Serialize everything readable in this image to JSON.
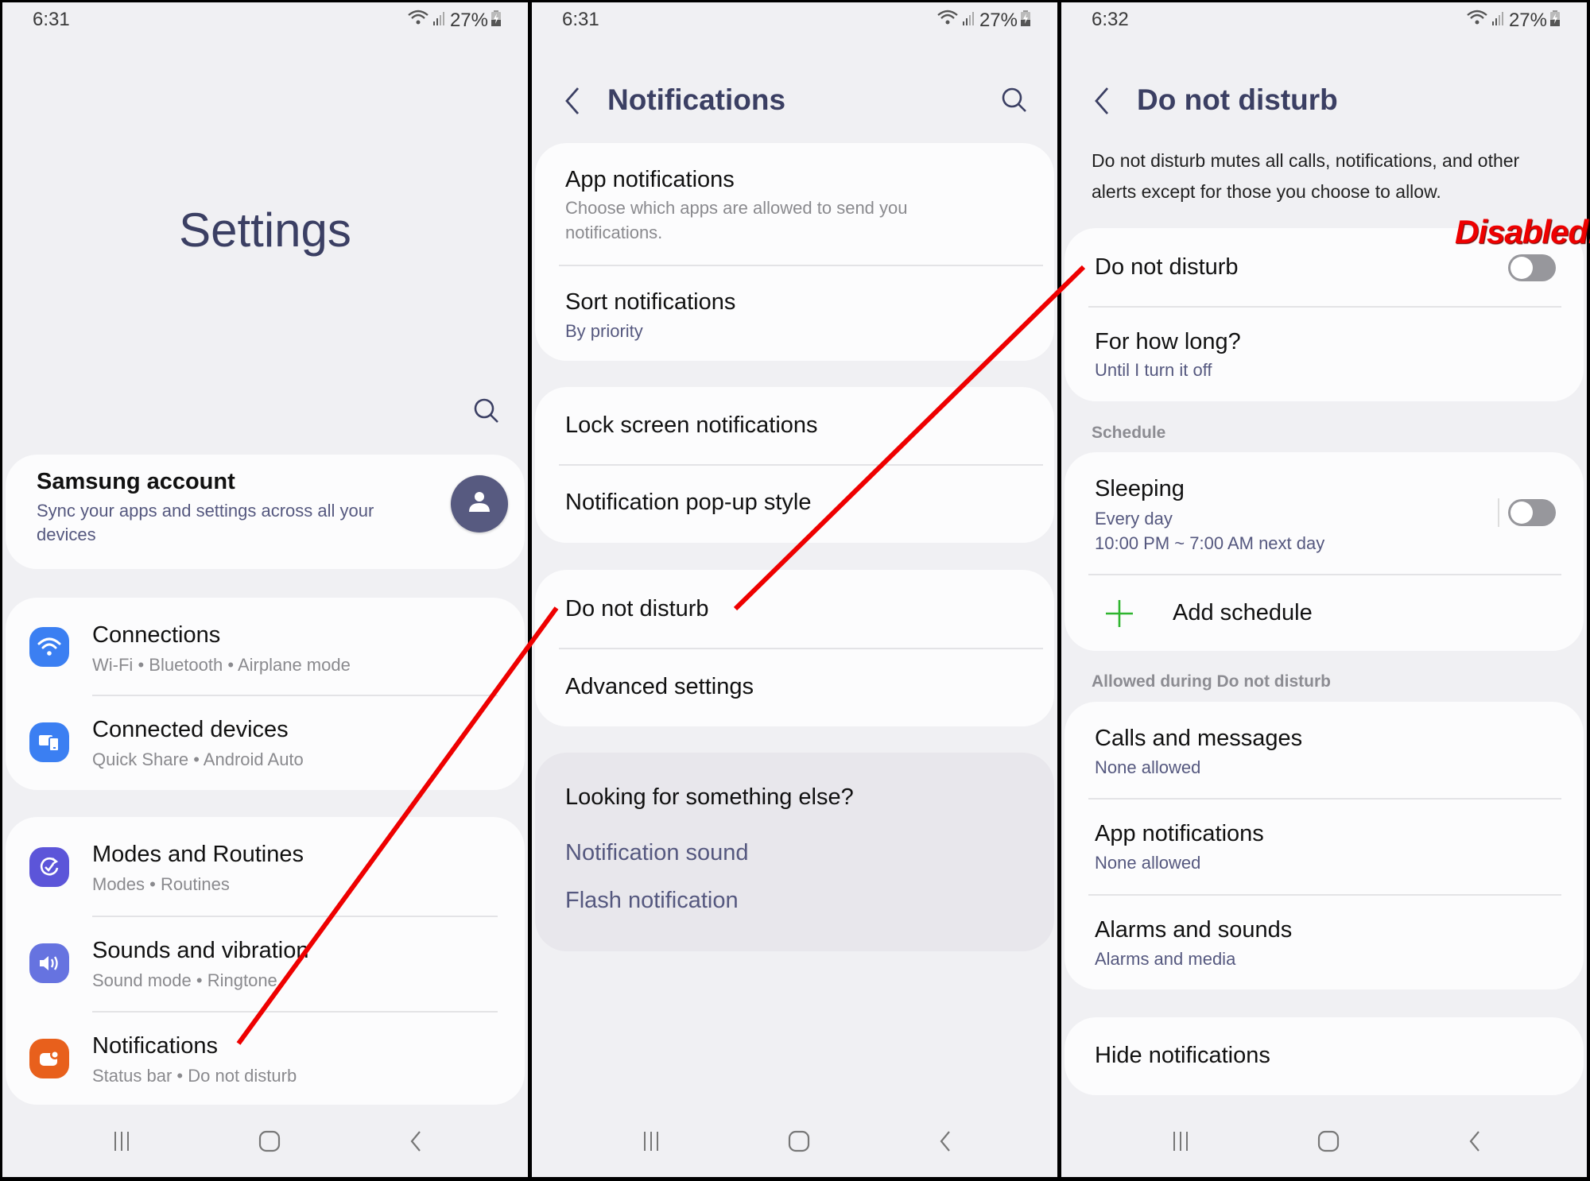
{
  "panels": [
    {
      "status": {
        "time": "6:31",
        "battery": "27%"
      },
      "title": "Settings",
      "account": {
        "title": "Samsung account",
        "subtitle_line1": "Sync your apps and settings across all your",
        "subtitle_line2": "devices"
      },
      "items": [
        {
          "label": "Connections",
          "sub": [
            "Wi-Fi",
            "Bluetooth",
            "Airplane mode"
          ],
          "icon": "wifi-icon",
          "color": "#3b7ff2"
        },
        {
          "label": "Connected devices",
          "sub": [
            "Quick Share",
            "Android Auto"
          ],
          "icon": "connected-devices-icon",
          "color": "#3b7ff2"
        },
        {
          "label": "Modes and Routines",
          "sub": [
            "Modes",
            "Routines"
          ],
          "icon": "modes-routines-icon",
          "color": "#5c55d9"
        },
        {
          "label": "Sounds and vibration",
          "sub": [
            "Sound mode",
            "Ringtone"
          ],
          "icon": "speaker-icon",
          "color": "#6673e0"
        },
        {
          "label": "Notifications",
          "sub": [
            "Status bar",
            "Do not disturb"
          ],
          "icon": "notification-icon",
          "color": "#e8601c"
        }
      ],
      "sub_separator": "•"
    },
    {
      "status": {
        "time": "6:31",
        "battery": "27%"
      },
      "title": "Notifications",
      "app_notifications": {
        "title": "App notifications",
        "desc_line1": "Choose which apps are allowed to send you",
        "desc_line2": "notifications."
      },
      "sort": {
        "title": "Sort notifications",
        "value": "By priority"
      },
      "lock_screen": "Lock screen notifications",
      "popup_style": "Notification pop-up style",
      "dnd": "Do not disturb",
      "advanced": "Advanced settings",
      "looking": {
        "title": "Looking for something else?",
        "links": [
          "Notification sound",
          "Flash notification"
        ]
      }
    },
    {
      "status": {
        "time": "6:32",
        "battery": "27%"
      },
      "title": "Do not disturb",
      "desc_line1": "Do not disturb mutes all calls, notifications, and other",
      "desc_line2": "alerts except for those you choose to allow.",
      "dnd_toggle": {
        "label": "Do not disturb",
        "on": false
      },
      "how_long": {
        "title": "For how long?",
        "value": "Until I turn it off"
      },
      "schedule_label": "Schedule",
      "sleeping": {
        "title": "Sleeping",
        "days": "Every day",
        "time": "10:00 PM ~ 7:00 AM next day",
        "on": false
      },
      "add_schedule": "Add schedule",
      "allowed_label": "Allowed during Do not disturb",
      "allowed": [
        {
          "title": "Calls and messages",
          "value": "None allowed"
        },
        {
          "title": "App notifications",
          "value": "None allowed"
        },
        {
          "title": "Alarms and sounds",
          "value": "Alarms and media"
        }
      ],
      "hide": "Hide notifications"
    }
  ],
  "annotation": {
    "text": "Disabled!",
    "color": "#ee0000"
  },
  "colors": {
    "accent": "#3b3f63",
    "subtitle_accent": "#55587f",
    "background": "#f0f0f3",
    "card": "#fcfcfd"
  }
}
